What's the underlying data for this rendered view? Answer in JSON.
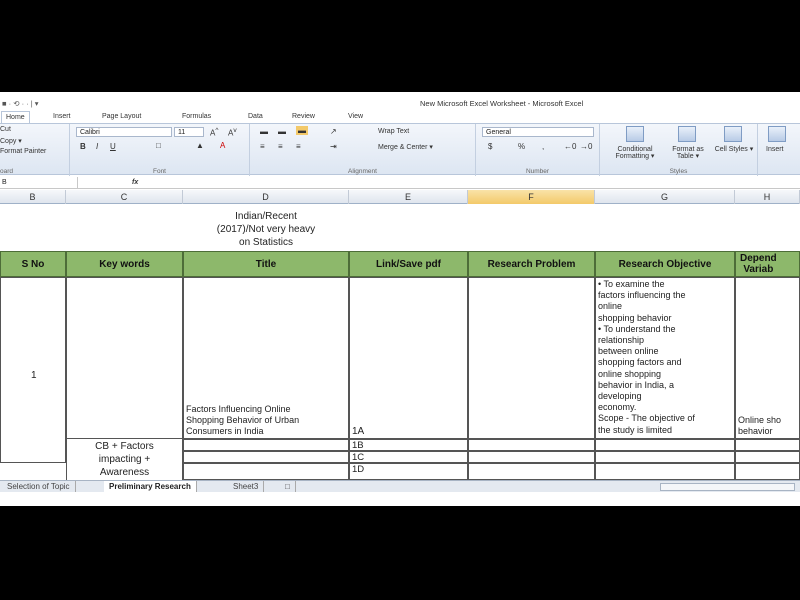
{
  "window": {
    "qat": "■ · ⟲ · · | ▾",
    "title": "New Microsoft Excel Worksheet - Microsoft Excel"
  },
  "ribbon_tabs": [
    "Home",
    "Insert",
    "Page Layout",
    "Formulas",
    "Data",
    "Review",
    "View"
  ],
  "ribbon": {
    "clipboard": {
      "cut": "Cut",
      "copy": "Copy ▾",
      "format_painter": "Format Painter",
      "label": "oard"
    },
    "font": {
      "name": "Calibri",
      "size": "11",
      "label": "Font"
    },
    "alignment": {
      "wrap": "Wrap Text",
      "merge": "Merge & Center ▾",
      "label": "Alignment"
    },
    "number": {
      "format": "General",
      "label": "Number"
    },
    "styles": {
      "conditional": "Conditional Formatting ▾",
      "format_table": "Format as Table ▾",
      "cell_styles": "Cell Styles ▾",
      "label": "Styles"
    },
    "cells": {
      "insert": "Insert"
    }
  },
  "formula_bar": {
    "namebox": "B",
    "fx": "fx",
    "value": ""
  },
  "columns": [
    "B",
    "C",
    "D",
    "E",
    "F",
    "G",
    "H"
  ],
  "sheet": {
    "note": "Indian/Recent\n(2017)/Not very heavy\non Statistics",
    "headers": {
      "sno": "S No",
      "keywords": "Key words",
      "title": "Title",
      "link": "Link/Save pdf",
      "problem": "Research Problem",
      "objective": "Research Objective",
      "dependent": "Depend\nVariab"
    },
    "row1": {
      "sno": "1",
      "title": "Factors Influencing Online\nShopping Behavior of Urban\nConsumers in India",
      "link": "1A",
      "objective": "• To examine the\nfactors influencing the\nonline\nshopping behavior\n• To understand the\nrelationship\nbetween online\nshopping factors and\nonline shopping\nbehavior in India, a\ndeveloping\neconomy.\nScope - The objective of\nthe study is limited",
      "dependent": "Online sho\nbehavior"
    },
    "keywords2": "CB + Factors\nimpacting +\nAwareness",
    "links": [
      "1B",
      "1C",
      "1D"
    ]
  },
  "sheet_tabs": [
    "Selection of Topic",
    "Preliminary Research",
    "Sheet3"
  ],
  "colors": {
    "header_green": "#8db86b",
    "selected_column": "#f3c96a"
  }
}
